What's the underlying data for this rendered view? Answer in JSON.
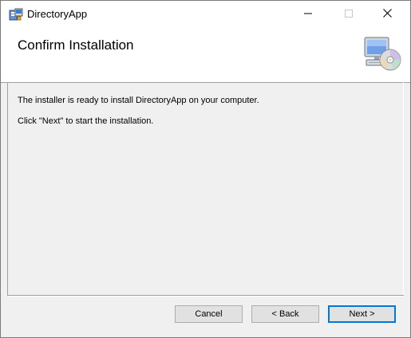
{
  "window": {
    "title": "DirectoryApp",
    "app_icon": "installer-icon",
    "controls": {
      "minimize": "minimize-icon",
      "maximize": "maximize-icon",
      "close": "close-icon"
    }
  },
  "header": {
    "title": "Confirm Installation",
    "image": "computer-cd-icon"
  },
  "body": {
    "line1": "The installer is ready to install DirectoryApp on your computer.",
    "line2": "Click \"Next\" to start the installation."
  },
  "buttons": {
    "cancel": "Cancel",
    "back": "< Back",
    "next": "Next >"
  },
  "colors": {
    "window_bg": "#f0f0f0",
    "header_bg": "#ffffff",
    "focus_border": "#0078d7"
  }
}
